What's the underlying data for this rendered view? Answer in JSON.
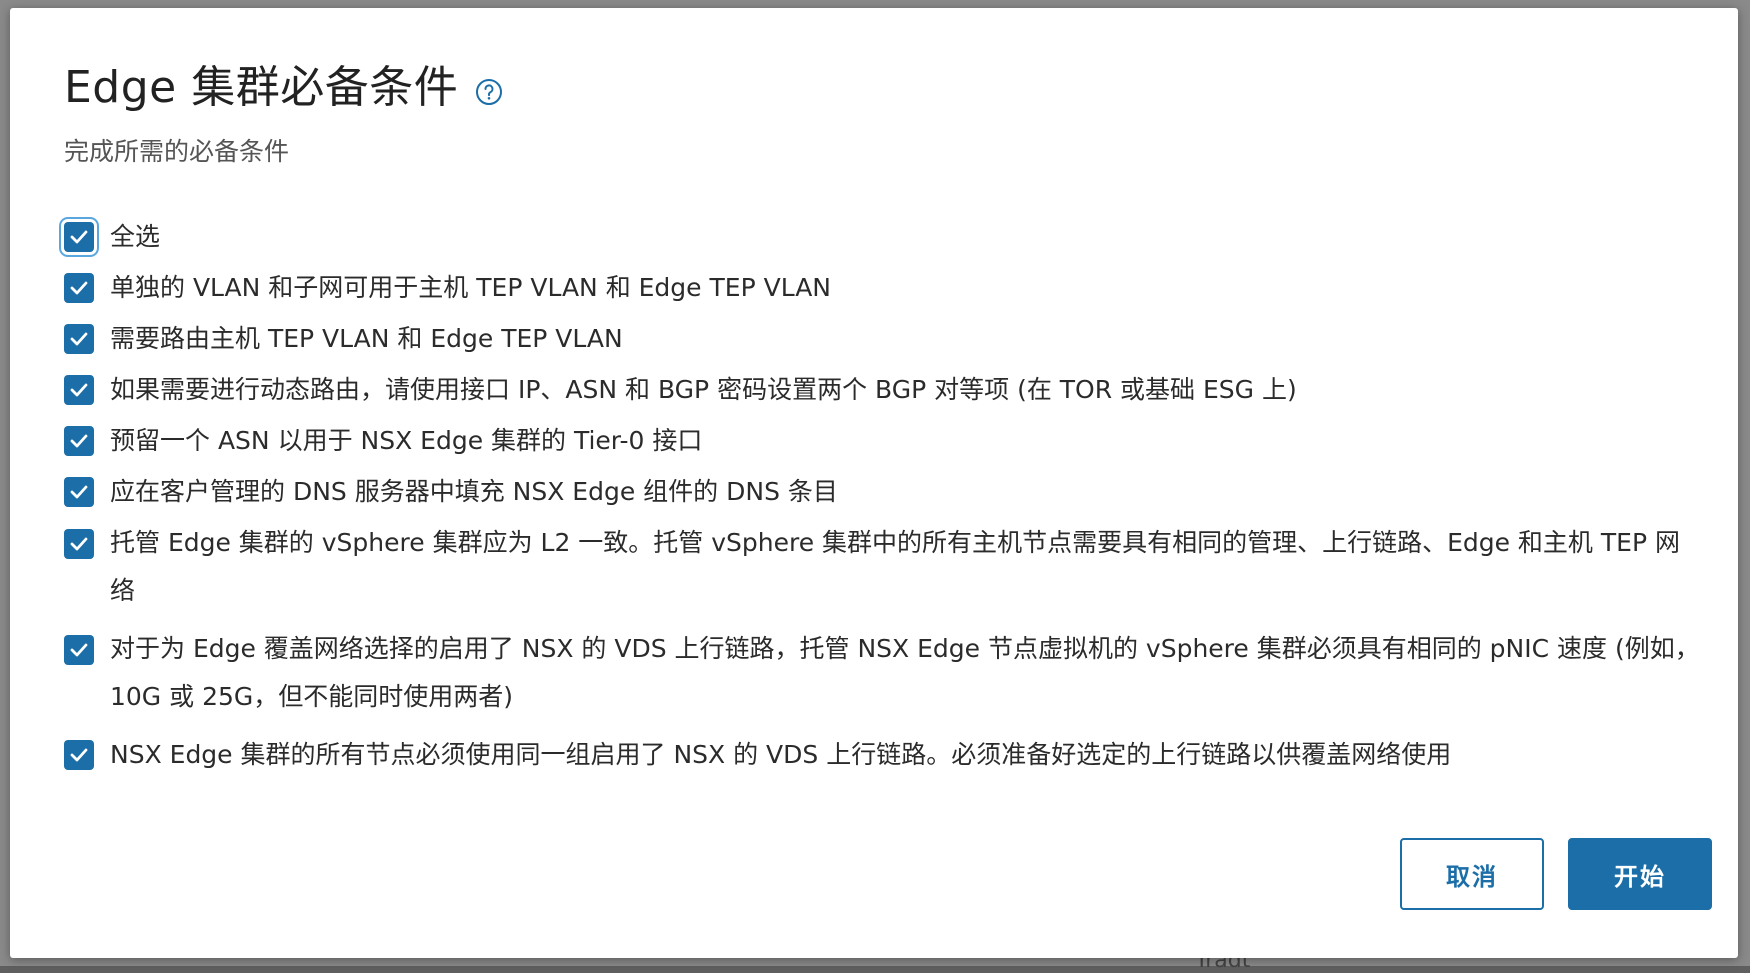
{
  "backdrop": {
    "partial_text": "Tradt"
  },
  "dialog": {
    "title": "Edge 集群必备条件",
    "subtitle": "完成所需的必备条件",
    "help_icon": "help-circle-icon",
    "accent_color": "#1b6ea8"
  },
  "prerequisites": {
    "select_all": {
      "label": "全选",
      "checked": true
    },
    "items": [
      {
        "label": "单独的 VLAN 和子网可用于主机 TEP VLAN 和 Edge TEP VLAN",
        "checked": true
      },
      {
        "label": "需要路由主机 TEP VLAN 和 Edge TEP VLAN",
        "checked": true
      },
      {
        "label": "如果需要进行动态路由，请使用接口 IP、ASN 和 BGP 密码设置两个 BGP 对等项 (在 TOR 或基础 ESG 上)",
        "checked": true
      },
      {
        "label": "预留一个 ASN 以用于 NSX Edge 集群的 Tier-0 接口",
        "checked": true
      },
      {
        "label": "应在客户管理的 DNS 服务器中填充 NSX Edge 组件的 DNS 条目",
        "checked": true
      },
      {
        "label": "托管 Edge 集群的 vSphere 集群应为 L2 一致。托管 vSphere 集群中的所有主机节点需要具有相同的管理、上行链路、Edge 和主机 TEP 网络",
        "checked": true
      },
      {
        "label": "对于为 Edge 覆盖网络选择的启用了 NSX 的 VDS 上行链路，托管 NSX Edge 节点虚拟机的 vSphere 集群必须具有相同的 pNIC 速度 (例如，10G 或 25G，但不能同时使用两者)",
        "checked": true
      },
      {
        "label": "NSX Edge 集群的所有节点必须使用同一组启用了 NSX 的 VDS 上行链路。必须准备好选定的上行链路以供覆盖网络使用",
        "checked": true
      }
    ]
  },
  "footer": {
    "cancel_label": "取消",
    "start_label": "开始"
  }
}
